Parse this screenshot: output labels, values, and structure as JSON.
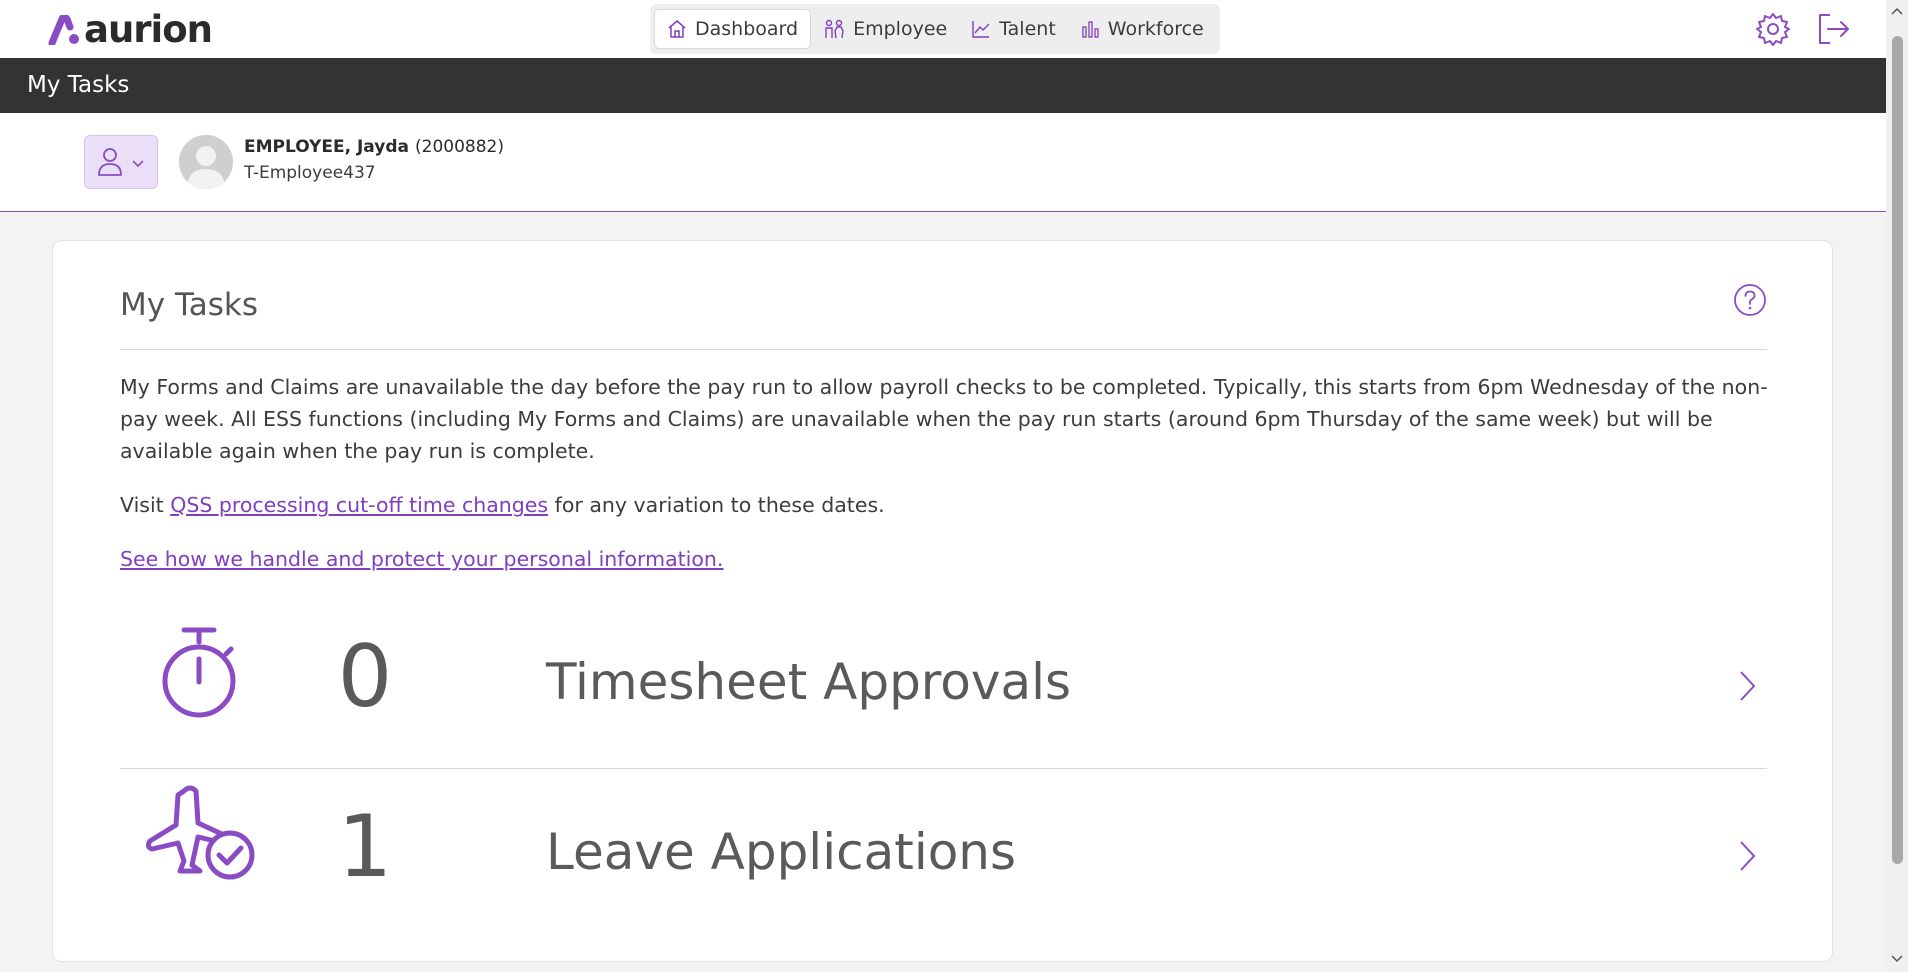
{
  "brand": {
    "name": "aurion",
    "accent": "#8a4cc2"
  },
  "nav": {
    "tabs": [
      {
        "label": "Dashboard",
        "icon": "home-icon"
      },
      {
        "label": "Employee",
        "icon": "people-icon"
      },
      {
        "label": "Talent",
        "icon": "trend-chart-icon"
      },
      {
        "label": "Workforce",
        "icon": "bar-chart-icon"
      }
    ],
    "active": "Dashboard"
  },
  "page": {
    "title": "My Tasks"
  },
  "user": {
    "name": "EMPLOYEE, Jayda",
    "id": "(2000882)",
    "subtitle": "T-Employee437"
  },
  "card": {
    "title": "My Tasks",
    "notice": "My Forms and Claims are unavailable the day before the pay run to allow payroll checks to be completed. Typically, this starts from 6pm Wednesday of the non-pay week. All ESS functions (including My Forms and Claims) are unavailable when the pay run starts (around 6pm Thursday of the same week) but will be available again when the pay run is complete.",
    "visit_prefix": "Visit ",
    "visit_link": "QSS processing cut-off time changes",
    "visit_suffix": " for any variation to these dates.",
    "privacy_link": "See how we handle and protect your personal information."
  },
  "tasks": [
    {
      "count": "0",
      "label": "Timesheet Approvals",
      "icon": "stopwatch-icon"
    },
    {
      "count": "1",
      "label": "Leave Applications",
      "icon": "plane-check-icon"
    }
  ]
}
